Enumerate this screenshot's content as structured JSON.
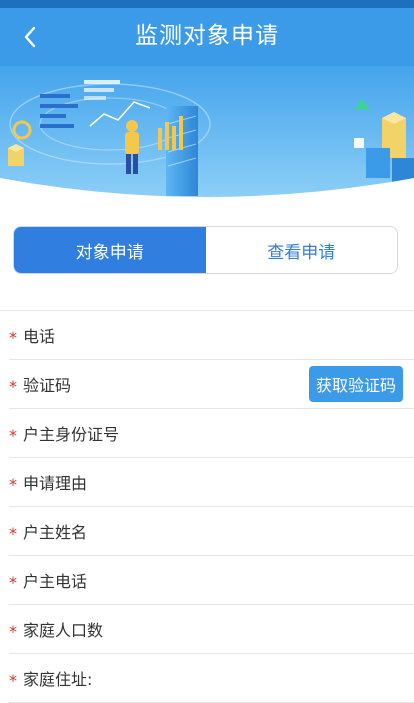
{
  "header": {
    "title": "监测对象申请",
    "back_icon": "chevron-left-icon"
  },
  "colors": {
    "header_bg": "#3c9be8",
    "accent": "#2f7ee0",
    "required": "#e0302b"
  },
  "tabs": [
    {
      "label": "对象申请",
      "active": true
    },
    {
      "label": "查看申请",
      "active": false
    }
  ],
  "form": {
    "required_mark": "*",
    "fields": [
      {
        "label": "电话"
      },
      {
        "label": "验证码",
        "action": "获取验证码"
      },
      {
        "label": "户主身份证号"
      },
      {
        "label": "申请理由"
      },
      {
        "label": "户主姓名"
      },
      {
        "label": "户主电话"
      },
      {
        "label": "家庭人口数"
      },
      {
        "label": "家庭住址:"
      }
    ]
  }
}
